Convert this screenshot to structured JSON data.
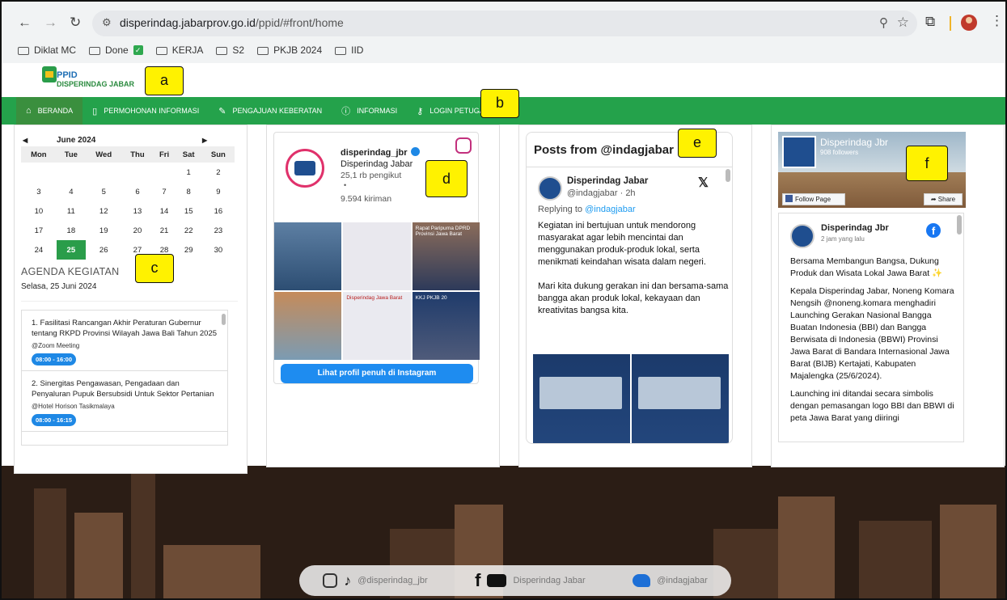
{
  "browser": {
    "url_domain": "disperindag.jabarprov.go.id",
    "url_path": "/ppid/#front/home",
    "bookmarks": [
      {
        "label": "Diklat MC"
      },
      {
        "label": "Done",
        "badge": "✓"
      },
      {
        "label": "KERJA"
      },
      {
        "label": "S2"
      },
      {
        "label": "PKJB 2024"
      },
      {
        "label": "IID"
      }
    ]
  },
  "site": {
    "logo_line1": "PPID",
    "logo_line2": "DISPERINDAG JABAR",
    "nav": [
      {
        "label": "BERANDA",
        "icon": "home-icon"
      },
      {
        "label": "PERMOHONAN INFORMASI",
        "icon": "document-icon"
      },
      {
        "label": "PENGAJUAN KEBERATAN",
        "icon": "edit-icon"
      },
      {
        "label": "INFORMASI",
        "icon": "info-icon"
      },
      {
        "label": "LOGIN PETUGAS",
        "icon": "key-icon"
      }
    ],
    "accent_color": "#24a24b"
  },
  "calendar": {
    "month": "June 2024",
    "prev": "◀",
    "next": "▶",
    "weekdays": [
      "Mon",
      "Tue",
      "Wed",
      "Thu",
      "Fri",
      "Sat",
      "Sun"
    ],
    "weeks": [
      [
        "",
        "",
        "",
        "",
        "",
        "1",
        "2"
      ],
      [
        "3",
        "4",
        "5",
        "6",
        "7",
        "8",
        "9"
      ],
      [
        "10",
        "11",
        "12",
        "13",
        "14",
        "15",
        "16"
      ],
      [
        "17",
        "18",
        "19",
        "20",
        "21",
        "22",
        "23"
      ],
      [
        "24",
        "25",
        "26",
        "27",
        "28",
        "29",
        "30"
      ]
    ],
    "today": "25"
  },
  "agenda": {
    "title": "AGENDA KEGIATAN",
    "date": "Selasa, 25 Juni 2024",
    "items": [
      {
        "title": "1. Fasilitasi Rancangan Akhir Peraturan Gubernur tentang RKPD Provinsi Wilayah Jawa Bali Tahun 2025",
        "location": "@Zoom Meeting",
        "time": "08:00 - 16:00"
      },
      {
        "title": "2. Sinergitas Pengawasan, Pengadaan dan Penyaluran Pupuk Bersubsidi Untuk Sektor Pertanian",
        "location": "@Hotel Horison Tasikmalaya",
        "time": "08:00 - 16:15"
      }
    ]
  },
  "instagram": {
    "username": "disperindag_jbr",
    "name": "Disperindag Jabar",
    "followers": "25,1 rb pengikut",
    "dot": "•",
    "posts": "9.594 kiriman",
    "tiles": [
      "",
      "",
      "Rapat Paripurna DPRD Provinsi Jawa Barat",
      "",
      "Disperindag Jawa Barat",
      "KKJ PKJB 20"
    ],
    "button": "Lihat profil penuh di Instagram"
  },
  "twitter": {
    "title": "Posts from @indagjabar",
    "name": "Disperindag Jabar",
    "handle": "@indagjabar · 2h",
    "reply_prefix": "Replying to",
    "reply_handle": "@indagjabar",
    "para1": "Kegiatan ini bertujuan untuk mendorong masyarakat agar lebih mencintai dan menggunakan produk-produk lokal, serta menikmati keindahan wisata dalam negeri.",
    "para2": "Mari kita dukung gerakan ini dan bersama-sama bangga akan produk lokal, kekayaan dan kreativitas bangsa kita."
  },
  "facebook": {
    "page_name": "Disperindag Jbr",
    "followers": "908 followers",
    "follow": "Follow Page",
    "share": "Share",
    "post_name": "Disperindag Jbr",
    "post_time": "2 jam yang lalu",
    "para1": "Bersama Membangun Bangsa, Dukung Produk dan Wisata Lokal Jawa Barat ✨",
    "para2": "Kepala Disperindag Jabar, Noneng Komara Nengsih @noneng.komara menghadiri Launching Gerakan Nasional Bangga Buatan Indonesia (BBI) dan Bangga Berwisata di Indonesia (BBWI) Provinsi Jawa Barat di Bandara Internasional Jawa Barat (BIJB) Kertajati, Kabupaten Majalengka (25/6/2024).",
    "para3": "Launching ini ditandai secara simbolis dengan pemasangan logo BBI dan BBWI di peta Jawa Barat yang diiringi"
  },
  "footer": {
    "instagram": "@disperindag_jbr",
    "youtube": "Disperindag Jabar",
    "twitter": "@indagjabar"
  },
  "annotations": [
    "a",
    "b",
    "c",
    "d",
    "e",
    "f"
  ]
}
